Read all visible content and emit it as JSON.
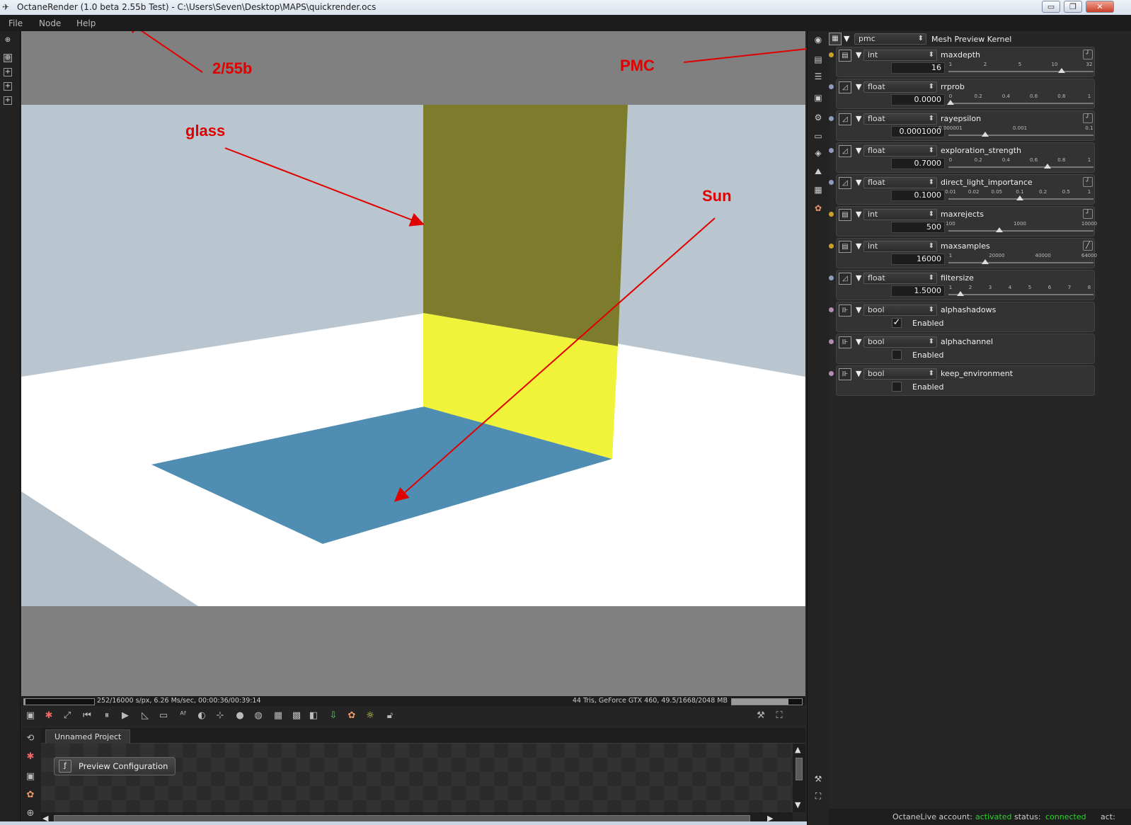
{
  "window": {
    "title": "OctaneRender (1.0 beta 2.55b Test) - C:\\Users\\Seven\\Desktop\\MAPS\\quickrender.ocs",
    "minimize": "▭",
    "maximize": "❐",
    "close": "✕"
  },
  "menu": [
    "File",
    "Node",
    "Help"
  ],
  "annotations": {
    "version": "2/55b",
    "pmc": "PMC",
    "glass": "glass",
    "sun": "Sun"
  },
  "status": {
    "left": "252/16000 s/px, 6.26 Ms/sec, 00:00:36/00:39:14",
    "right": "44 Tris, GeForce GTX 460, 49.5/1668/2048 MB",
    "render_progress": 0.016,
    "memory_progress": 0.81
  },
  "graph": {
    "tab": "Unnamed Project",
    "node_label": "Preview Configuration"
  },
  "kernel": {
    "type": "pmc",
    "label": "Mesh Preview Kernel"
  },
  "params": [
    {
      "type": "int",
      "name": "maxdepth",
      "value": "16",
      "dot": "#c9a227",
      "ticks": [
        "1",
        "2",
        "5",
        "10",
        "32"
      ],
      "thumb": 0.8
    },
    {
      "type": "float",
      "name": "rrprob",
      "value": "0.0000",
      "dot": "#8f9bbd",
      "ticks": [
        "0",
        "0.2",
        "0.4",
        "0.6",
        "0.8",
        "1"
      ],
      "thumb": 0.0
    },
    {
      "type": "float",
      "name": "rayepsilon",
      "value": "0.0001000",
      "dot": "#8f9bbd",
      "ticks": [
        "0.000001",
        "0.001",
        "0.1"
      ],
      "thumb": 0.25
    },
    {
      "type": "float",
      "name": "exploration_strength",
      "value": "0.7000",
      "dot": "#8f9bbd",
      "ticks": [
        "0",
        "0.2",
        "0.4",
        "0.6",
        "0.8",
        "1"
      ],
      "thumb": 0.7
    },
    {
      "type": "float",
      "name": "direct_light_importance",
      "value": "0.1000",
      "dot": "#8f9bbd",
      "ticks": [
        "0.01",
        "0.02",
        "0.05",
        "0.1",
        "0.2",
        "0.5",
        "1"
      ],
      "thumb": 0.5
    },
    {
      "type": "int",
      "name": "maxrejects",
      "value": "500",
      "dot": "#c9a227",
      "ticks": [
        "100",
        "1000",
        "10000"
      ],
      "thumb": 0.35
    },
    {
      "type": "int",
      "name": "maxsamples",
      "value": "16000",
      "dot": "#c9a227",
      "ticks": [
        "1",
        "20000",
        "40000",
        "64000"
      ],
      "thumb": 0.25
    },
    {
      "type": "float",
      "name": "filtersize",
      "value": "1.5000",
      "dot": "#8f9bbd",
      "ticks": [
        "1",
        "2",
        "3",
        "4",
        "5",
        "6",
        "7",
        "8"
      ],
      "thumb": 0.07
    },
    {
      "type": "bool",
      "name": "alphashadows",
      "enabled_label": "Enabled",
      "checked": true,
      "dot": "#b58bb0"
    },
    {
      "type": "bool",
      "name": "alphachannel",
      "enabled_label": "Enabled",
      "checked": false,
      "dot": "#b58bb0"
    },
    {
      "type": "bool",
      "name": "keep_environment",
      "enabled_label": "Enabled",
      "checked": false,
      "dot": "#b58bb0"
    }
  ],
  "statusbar": {
    "account_label": "OctaneLive account:",
    "account_value": "activated",
    "status_label": "status:",
    "status_value": "connected",
    "act_label": "act:"
  },
  "colors": {
    "annotation_red": "#e10000",
    "glass_yellow": "#f1f23a",
    "shadow_blue": "#4f8db3",
    "wall": "#b9c6d0",
    "floor": "#ffffff",
    "connected_green": "#2bd32b"
  }
}
